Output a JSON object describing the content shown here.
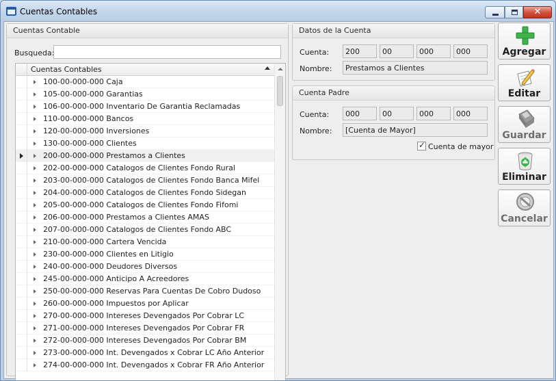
{
  "window": {
    "title": "Cuentas Contables"
  },
  "left_panel": {
    "title": "Cuentas Contable",
    "search_label": "Busqueda:",
    "search_value": "",
    "grid_header": "Cuentas Contables",
    "rows": [
      "100-00-000-000 Caja",
      "105-00-000-000 Garantias",
      "106-00-000-000 Inventario De Garantia Reclamadas",
      "110-00-000-000 Bancos",
      "120-00-000-000 Inversiones",
      "130-00-000-000 Clientes",
      "200-00-000-000 Prestamos a Clientes",
      "202-00-000-000 Catalogos de Clientes Fondo Rural",
      "203-00-000-000 Catalogos de Clientes Fondo Banca Mifel",
      "204-00-000-000 Catalogos de Clientes Fondo Sidegan",
      "205-00-000-000 Catalogos de Clientes Fondo Fifomi",
      "206-00-000-000 Prestamos a Clientes AMAS",
      "207-00-000-000 Catalogos de Clientes Fondo ABC",
      "210-00-000-000 Cartera Vencida",
      "230-00-000-000 Clientes en Litigio",
      "240-00-000-000 Deudores Diversos",
      "245-00-000-000 Anticipo A Acreedores",
      "250-00-000-000 Reservas Para Cuentas De Cobro Dudoso",
      "260-00-000-000 Impuestos por Aplicar",
      "270-00-000-000 Intereses Devengados Por Cobrar LC",
      "271-00-000-000 Intereses Devengados Por Cobrar FR",
      "272-00-000-000 Intereses Devengados Por Cobrar BM",
      "273-00-000-000 Int. Devengados x Cobrar LC Año Anterior",
      "274-00-000-000 Int. Devengados x Cobrar FR Año Anterior"
    ],
    "selected_index": 6
  },
  "datos_cuenta": {
    "title": "Datos de la Cuenta",
    "cuenta_label": "Cuenta:",
    "cuenta_parts": [
      "200",
      "00",
      "000",
      "000"
    ],
    "nombre_label": "Nombre:",
    "nombre_value": "Prestamos a Clientes"
  },
  "cuenta_padre": {
    "title": "Cuenta Padre",
    "cuenta_label": "Cuenta:",
    "cuenta_parts": [
      "000",
      "00",
      "000",
      "000"
    ],
    "nombre_label": "Nombre:",
    "nombre_value": "[Cuenta de Mayor]",
    "checkbox_label": "Cuenta de mayor",
    "checkbox_checked": true
  },
  "buttons": {
    "agregar": "Agregar",
    "editar": "Editar",
    "guardar": "Guardar",
    "eliminar": "Eliminar",
    "cancelar": "Cancelar"
  },
  "icons": {
    "agregar": "plus-icon",
    "editar": "edit-pencil-icon",
    "guardar": "floppy-disk-icon",
    "eliminar": "recycle-bin-icon",
    "cancelar": "cancel-circle-icon"
  },
  "colors": {
    "title_bar": "#c3d6ec",
    "close_button": "#c1321f",
    "add_green": "#3fb34a",
    "selected_row": "#f0f0f0"
  }
}
